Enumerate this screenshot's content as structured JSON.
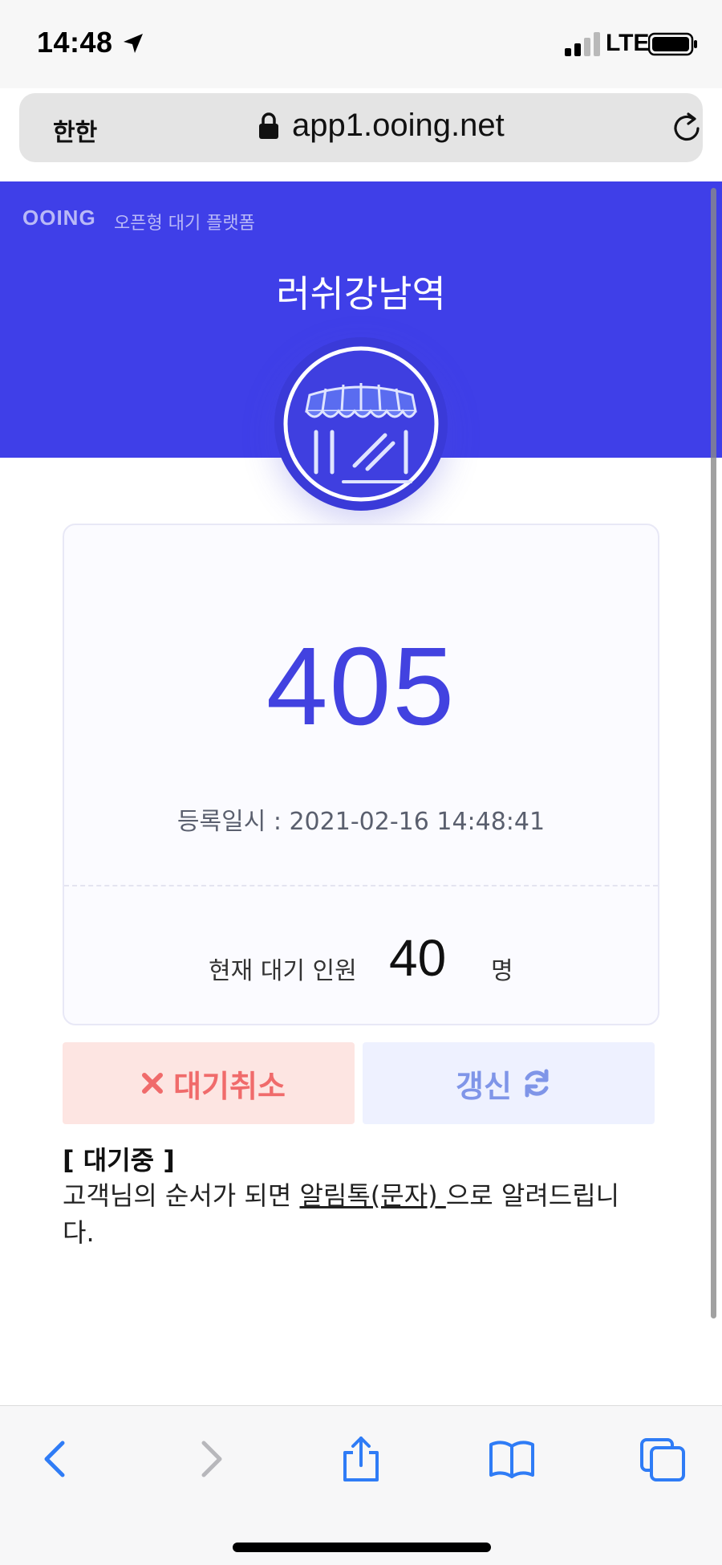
{
  "status_bar": {
    "time": "14:48",
    "network": "LTE",
    "icons": [
      "location-arrow-icon",
      "signal-icon",
      "battery-icon"
    ]
  },
  "browser": {
    "text_size_button": "한한",
    "url": "app1.ooing.net",
    "icons": [
      "lock-icon",
      "reload-icon"
    ]
  },
  "header": {
    "brand": "OOING",
    "brand_subtitle": "오픈형 대기 플랫폼",
    "store_name": "러쉬강남역",
    "logo_icon": "store-awning-icon",
    "background_color": "#3f3fe8"
  },
  "ticket": {
    "number": "405",
    "registered_label": "등록일시 : 2021-02-16 14:48:41",
    "waiting_label": "현재 대기 인원",
    "waiting_count": "40",
    "waiting_unit": "명",
    "accent_color": "#4242e0"
  },
  "actions": {
    "cancel_label": "대기취소",
    "cancel_icon": "close-x-icon",
    "refresh_label": "갱신",
    "refresh_icon": "refresh-icon"
  },
  "info": {
    "status_heading": "[ 대기중 ]",
    "message_before": "고객님의 순서가 되면 ",
    "message_link": "알림톡(문자) ",
    "message_after": "으로 알려드립니다."
  },
  "toolbar": {
    "icons": [
      "back-icon",
      "forward-icon",
      "share-icon",
      "bookmarks-icon",
      "tabs-icon"
    ]
  }
}
